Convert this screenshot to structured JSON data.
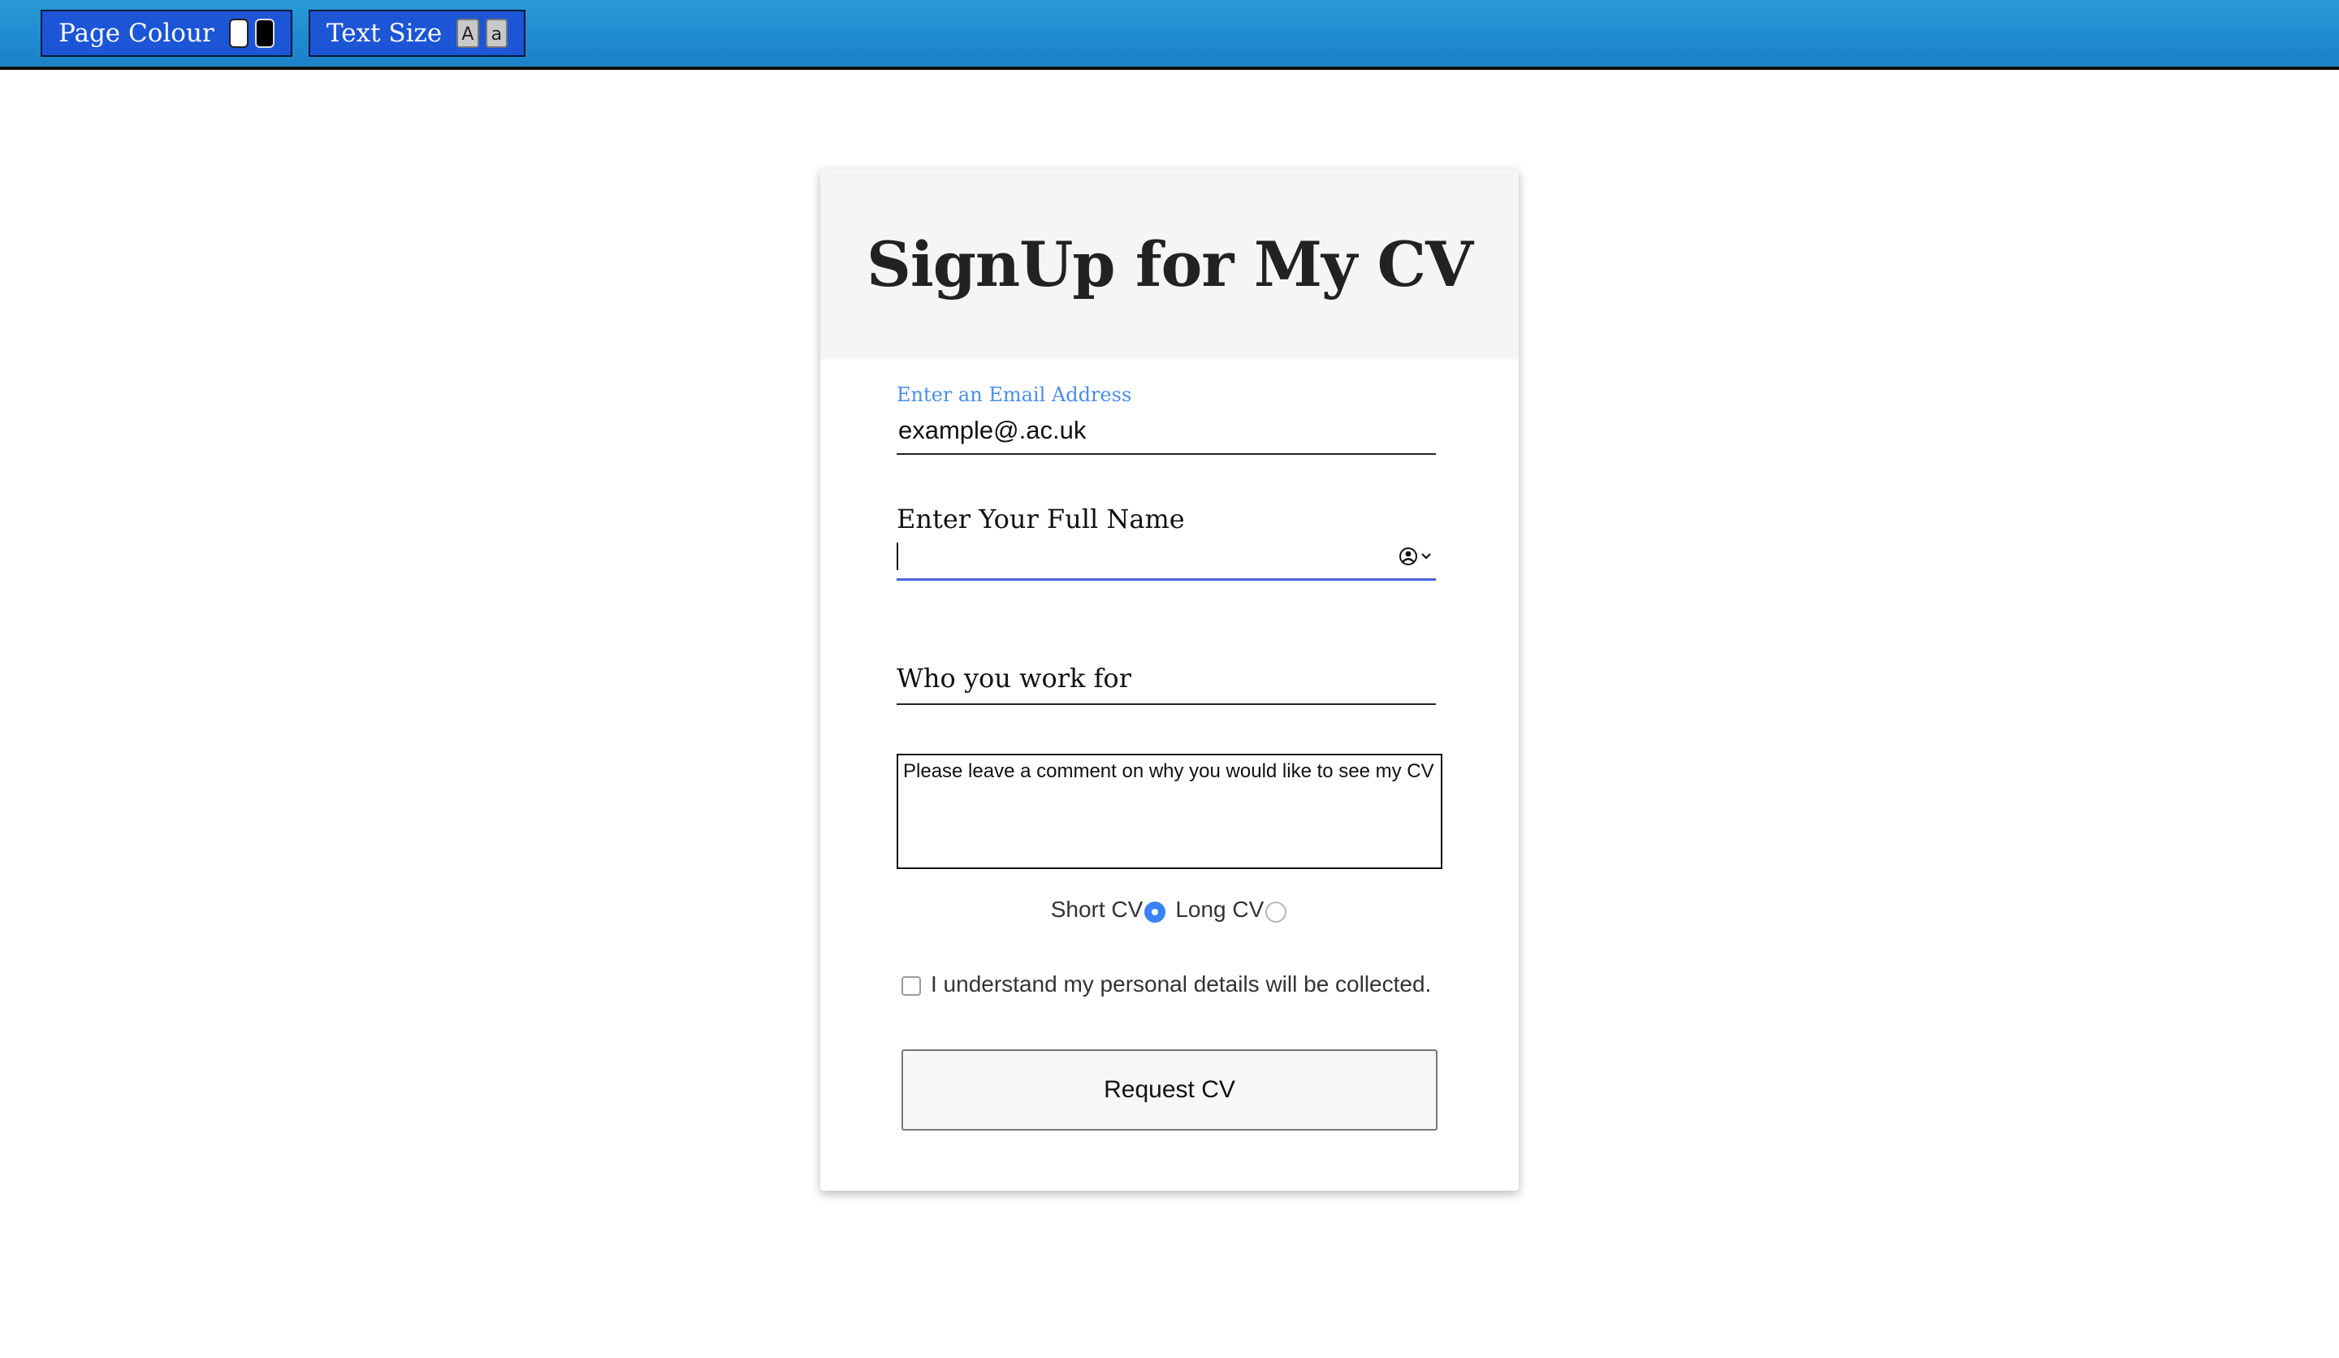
{
  "toolbar": {
    "page_colour_label": "Page Colour",
    "text_size_label": "Text Size",
    "swatches": [
      "#ffffff",
      "#000000"
    ],
    "size_buttons": [
      "A",
      "a"
    ]
  },
  "form": {
    "title": "SignUp for My CV",
    "email": {
      "label": "Enter an Email Address",
      "value": "example@.ac.uk"
    },
    "full_name": {
      "label": "Enter Your Full Name",
      "value": "",
      "autofill_icon": "contact-card-icon"
    },
    "employer": {
      "label": "Who you work for"
    },
    "comment": {
      "placeholder": "Please leave a comment on why you would like to see my CV"
    },
    "cv_type": {
      "options": [
        {
          "label": "Short CV",
          "selected": true
        },
        {
          "label": "Long CV",
          "selected": false
        }
      ]
    },
    "consent": {
      "label": "I understand my personal details will be collected.",
      "checked": false
    },
    "submit_label": "Request CV"
  },
  "colors": {
    "accent": "#3b82f6",
    "toolbar_bg": "#1f8bd0",
    "button_group_bg": "#1c55d6",
    "focused_underline": "#4a63d9",
    "floating_label": "#4a8ee8"
  }
}
